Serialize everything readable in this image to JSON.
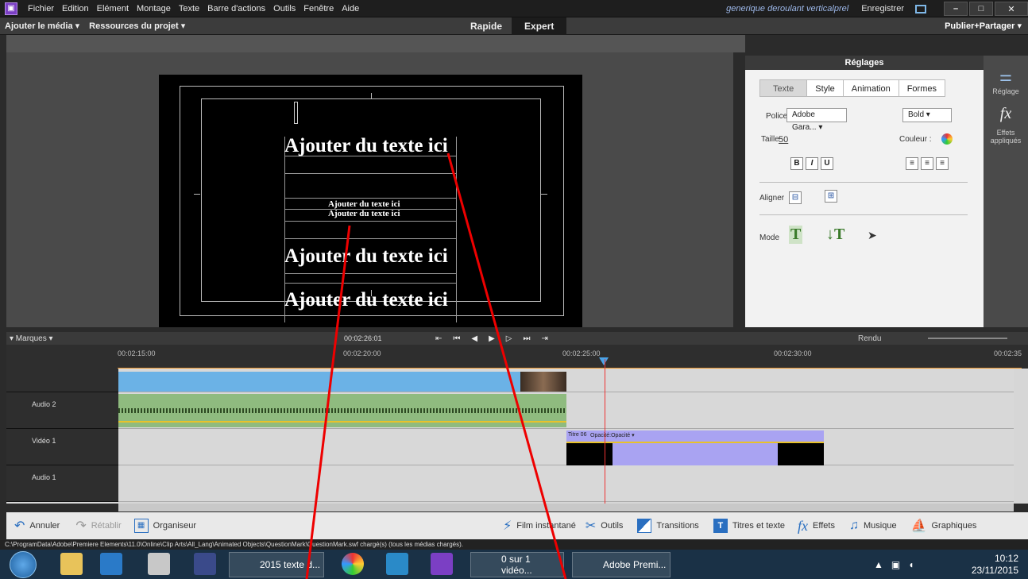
{
  "menu": {
    "items": [
      "Fichier",
      "Edition",
      "Elément",
      "Montage",
      "Texte",
      "Barre d'actions",
      "Outils",
      "Fenêtre",
      "Aide"
    ],
    "project_name": "generique deroulant verticalprel",
    "save": "Enregistrer"
  },
  "toolbar": {
    "add_media": "Ajouter le média ▾",
    "project_resources": "Ressources du projet ▾",
    "mode_rapide": "Rapide",
    "mode_expert": "Expert",
    "publish": "Publier+Partager ▾"
  },
  "monitor": {
    "title_1": "Ajouter du texte ici",
    "title_2": "Ajouter du texte ici",
    "title_3": "Ajouter du texte ici",
    "title_4": "Ajouter du texte ici",
    "title_5": "Ajouter du texte ici"
  },
  "settings": {
    "header": "Réglages",
    "tabs": [
      "Texte",
      "Style",
      "Animation",
      "Formes"
    ],
    "police_label": "Police",
    "police_value": "Adobe Gara... ▾",
    "style_value": "Bold ▾",
    "taille_label": "Taille",
    "taille_value": "50",
    "couleur_label": "Couleur :",
    "bold": "B",
    "italic": "I",
    "underline": "U",
    "aligner_label": "Aligner",
    "mode_label": "Mode",
    "rail_reglage": "Réglage",
    "rail_effets": "Effets appliqués"
  },
  "timeline": {
    "marks": "▾ Marques ▾",
    "current_time": "00:02:26:01",
    "render": "Rendu",
    "ruler": [
      "00:02:15:00",
      "00:02:20:00",
      "00:02:25:00",
      "00:02:30:00",
      "00:02:35"
    ],
    "tracks": {
      "audio2": "Audio 2",
      "video1": "Vidéo 1",
      "audio1": "Audio 1"
    },
    "clip_title": "Titre 06",
    "clip_opacity": "Opacité:Opacité ▾"
  },
  "actions": {
    "undo": "Annuler",
    "redo": "Rétablir",
    "organizer": "Organiseur",
    "film": "Film instantané",
    "tools": "Outils",
    "transitions": "Transitions",
    "titles": "Titres et texte",
    "effects": "Effets",
    "music": "Musique",
    "graphics": "Graphiques"
  },
  "status": "C:\\ProgramData\\Adobe\\Premiere Elements\\11.0\\Online\\Clip Arts\\All_Lang\\Animated Objects\\QuestionMark\\QuestionMark.swf chargé(s) (tous les médias chargés).",
  "taskbar": {
    "task1": "2015 texte d...",
    "task2": "0 sur 1 vidéo...",
    "task3": "Adobe Premi...",
    "time": "10:12",
    "date": "23/11/2015"
  }
}
